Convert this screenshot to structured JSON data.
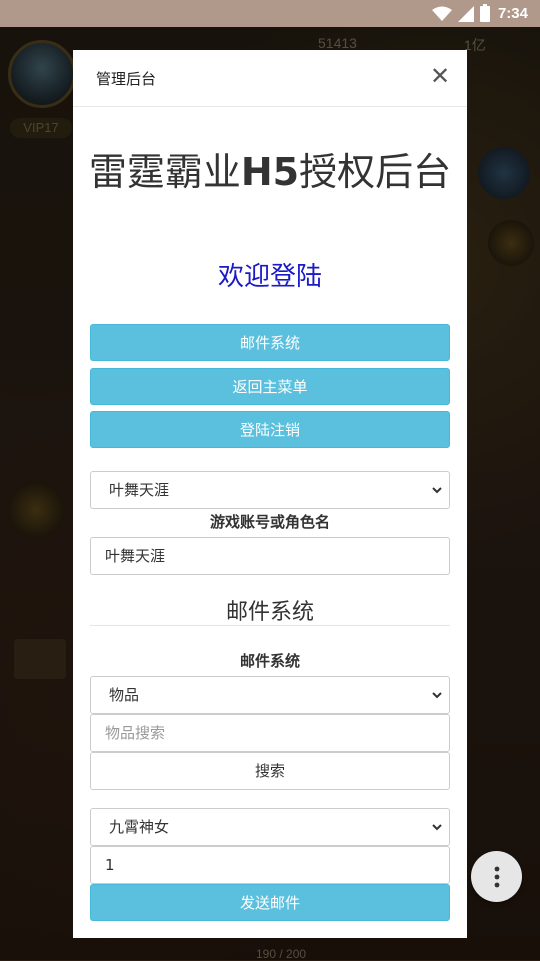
{
  "status_bar": {
    "time": "7:34",
    "icons": [
      "wifi-icon",
      "signal-icon",
      "battery-icon"
    ]
  },
  "game_hud": {
    "vip_label": "VIP17",
    "currency_1": "51413",
    "currency_2": "1亿",
    "bottom_counter": "190 / 200"
  },
  "dialog": {
    "title": "管理后台",
    "close_icon": "close-icon",
    "main_title_part1": "雷霆霸业",
    "main_title_bold": "H5",
    "main_title_part2": "授权后台",
    "welcome": "欢迎登陆",
    "buttons": {
      "mail_system": "邮件系统",
      "back_main_menu": "返回主菜单",
      "logout": "登陆注销"
    },
    "account_select": {
      "selected": "叶舞天涯"
    },
    "account_label": "游戏账号或角色名",
    "account_input": {
      "value": "叶舞天涯"
    },
    "section_title": "邮件系统",
    "section_label": "邮件系统",
    "item_type_select": {
      "selected": "物品"
    },
    "item_search_input": {
      "placeholder": "物品搜索",
      "value": ""
    },
    "search_button": "搜索",
    "item_select": {
      "selected": "九霄神女"
    },
    "quantity_input": {
      "value": "1"
    },
    "send_button": "发送邮件"
  },
  "colors": {
    "info_button": "#5bc0de",
    "welcome_text": "#1a1ac8",
    "status_bar": "#b0988a"
  },
  "fab": {
    "icon": "more-vertical-icon"
  }
}
